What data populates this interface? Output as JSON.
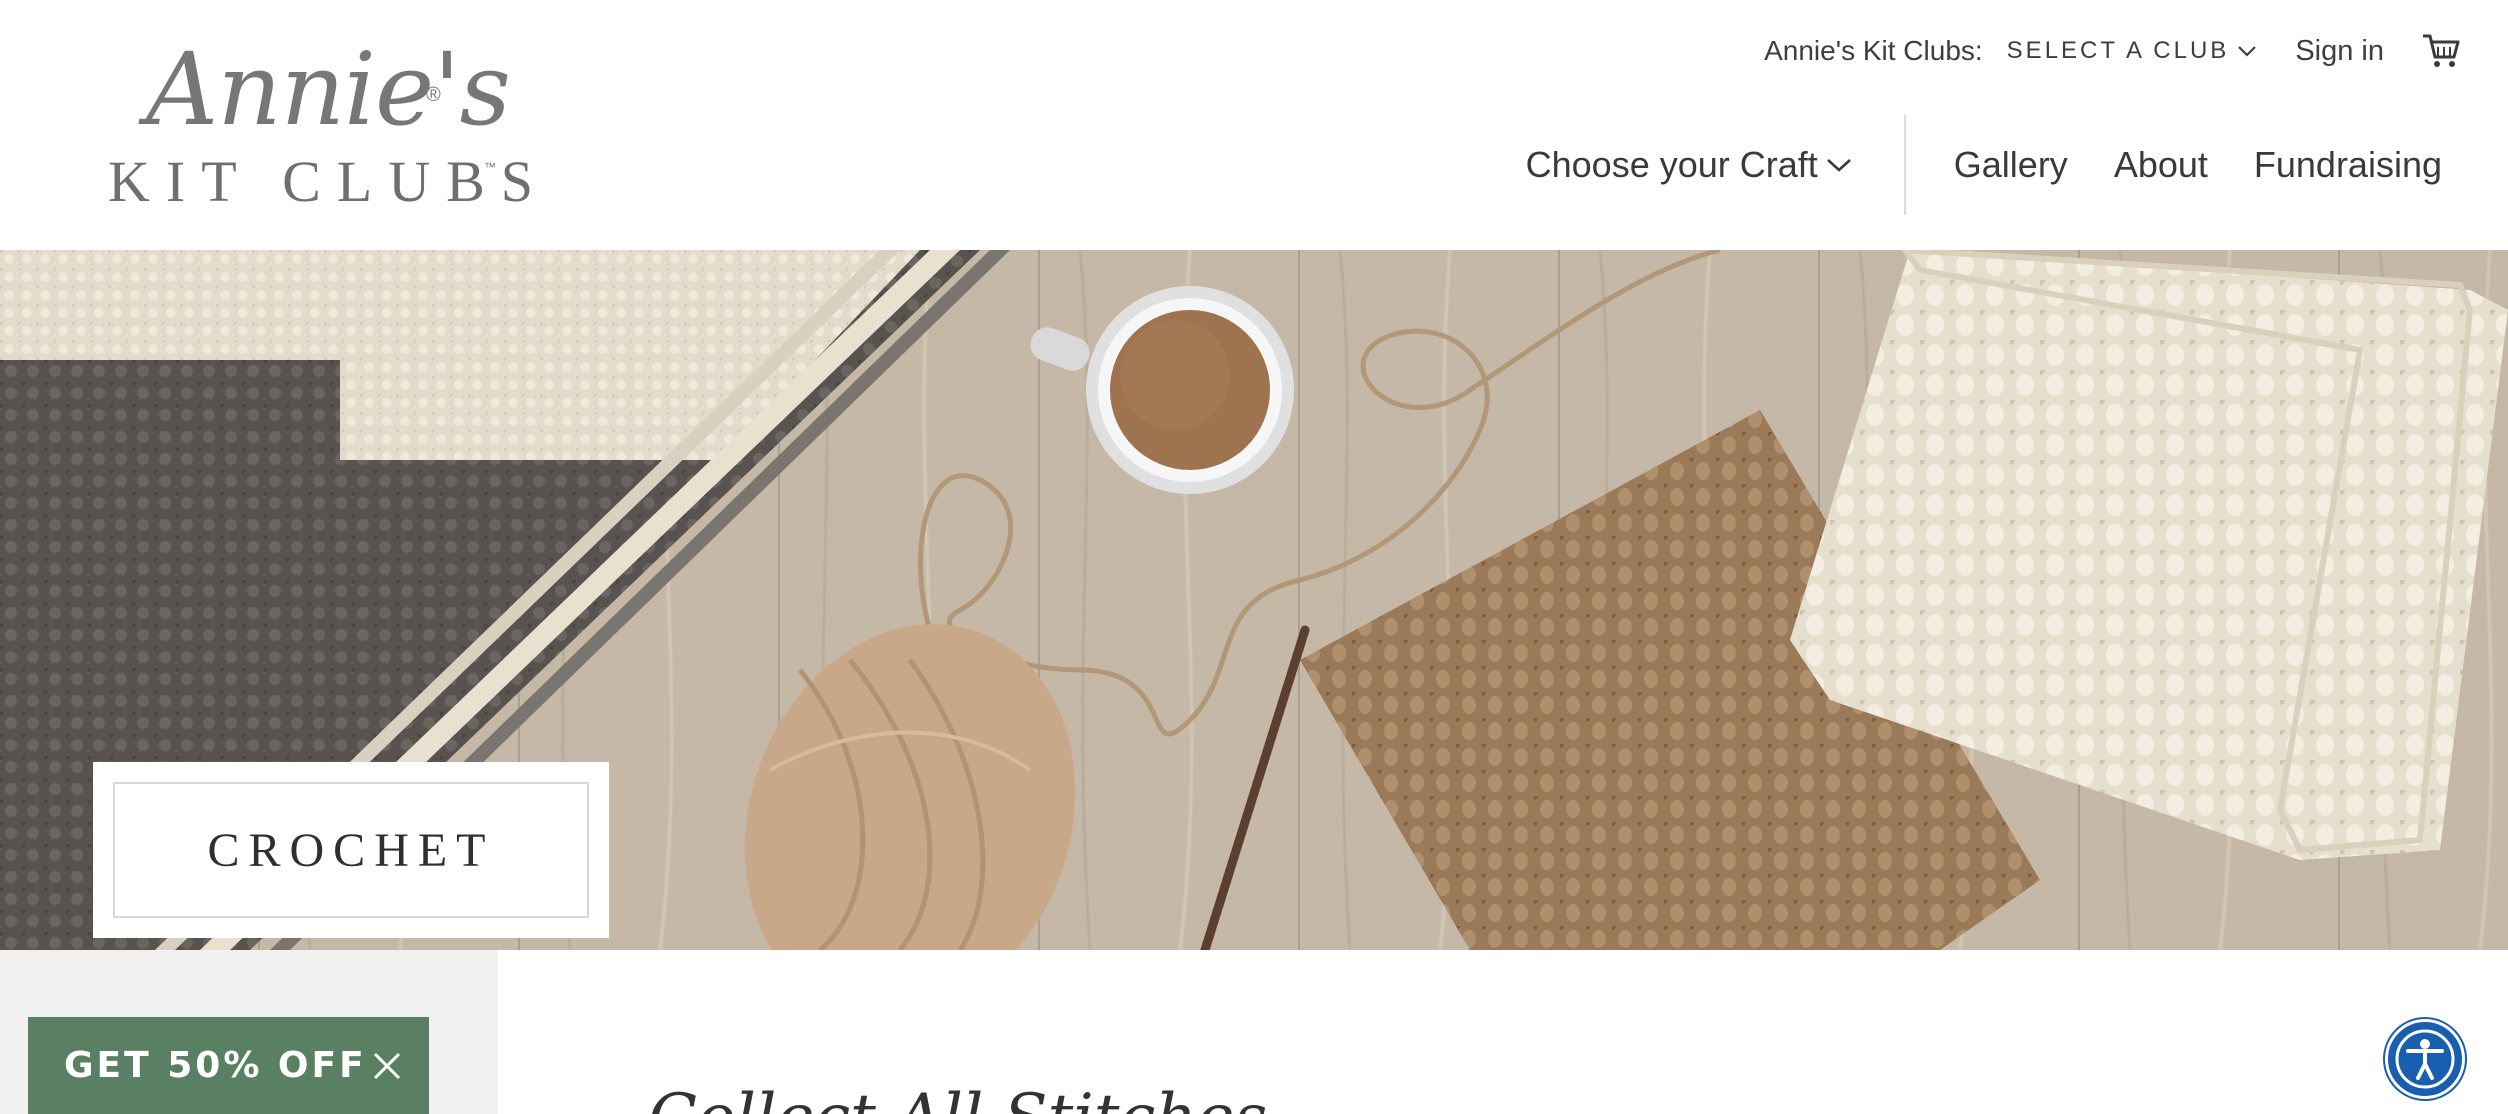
{
  "logo": {
    "script": "Annie's",
    "registered": "®",
    "subtitle": "KIT CLUBS",
    "trademark": "™"
  },
  "utility": {
    "clubs_label": "Annie's Kit Clubs:",
    "club_select": "SELECT A CLUB",
    "sign_in": "Sign in",
    "cart_icon": "cart-icon"
  },
  "nav": {
    "choose_craft": "Choose your Craft",
    "gallery": "Gallery",
    "about": "About",
    "fundraising": "Fundraising"
  },
  "hero": {
    "title": "CROCHET"
  },
  "section": {
    "heading_peek": "Collect All Stitches"
  },
  "promo": {
    "label": "GET 50% OFF",
    "close_icon": "close-icon"
  },
  "accessibility": {
    "icon": "accessibility-icon",
    "color": "#1a5eb0"
  },
  "colors": {
    "promo_bg": "#5a8063",
    "text": "#3d3d3d",
    "logo_gray": "#77777a"
  }
}
